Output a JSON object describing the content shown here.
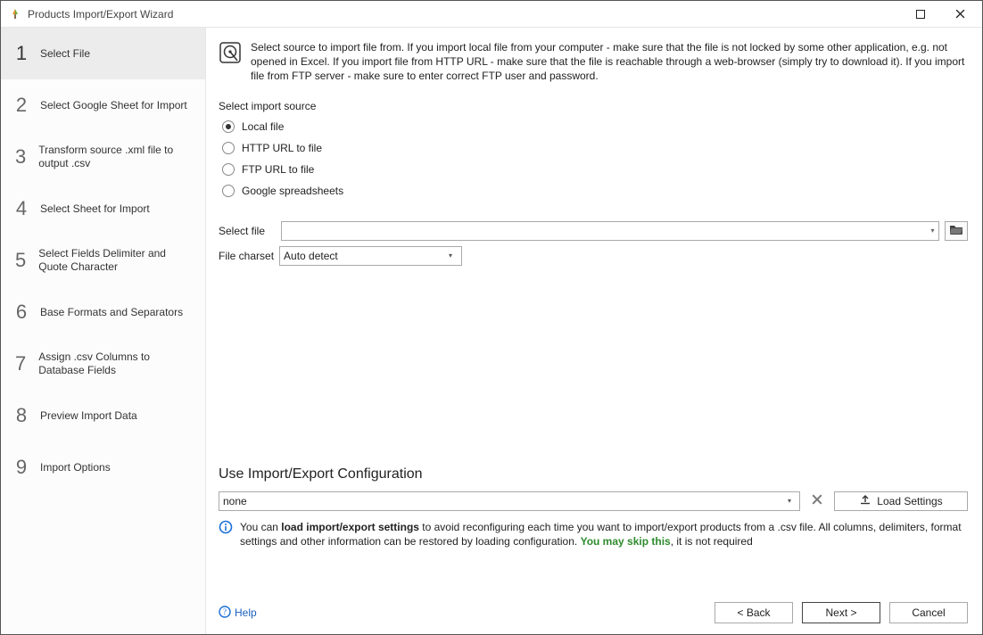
{
  "window": {
    "title": "Products Import/Export Wizard"
  },
  "steps": [
    {
      "num": "1",
      "label": "Select File",
      "active": true
    },
    {
      "num": "2",
      "label": "Select Google Sheet for Import"
    },
    {
      "num": "3",
      "label": "Transform source .xml file to output .csv"
    },
    {
      "num": "4",
      "label": "Select Sheet for Import"
    },
    {
      "num": "5",
      "label": "Select Fields Delimiter and Quote Character"
    },
    {
      "num": "6",
      "label": "Base Formats and Separators"
    },
    {
      "num": "7",
      "label": "Assign .csv Columns to Database Fields"
    },
    {
      "num": "8",
      "label": "Preview Import Data"
    },
    {
      "num": "9",
      "label": "Import Options"
    }
  ],
  "description": "Select source to import file from. If you import local file from your computer - make sure that the file is not locked by some other application, e.g. not opened in Excel. If you import file from HTTP URL - make sure that the file is reachable through a web-browser (simply try to download it). If you import file from FTP server - make sure to enter correct FTP user and password.",
  "import_source": {
    "label": "Select import source",
    "options": [
      {
        "label": "Local file",
        "selected": true
      },
      {
        "label": "HTTP URL to file",
        "selected": false
      },
      {
        "label": "FTP URL to file",
        "selected": false
      },
      {
        "label": "Google spreadsheets",
        "selected": false
      }
    ]
  },
  "file": {
    "label": "Select file",
    "value": ""
  },
  "charset": {
    "label": "File charset",
    "value": "Auto detect"
  },
  "config": {
    "title": "Use Import/Export Configuration",
    "value": "none",
    "load_label": "Load Settings",
    "note_prefix": "You can ",
    "note_bold": "load import/export settings",
    "note_mid": " to avoid reconfiguring each time you want to import/export products from a .csv file. All columns, delimiters, format settings and other information can be restored by loading configuration. ",
    "note_green": "You may skip this",
    "note_suffix": ", it is not required"
  },
  "footer": {
    "help": "Help",
    "back": "< Back",
    "next": "Next >",
    "cancel": "Cancel"
  }
}
